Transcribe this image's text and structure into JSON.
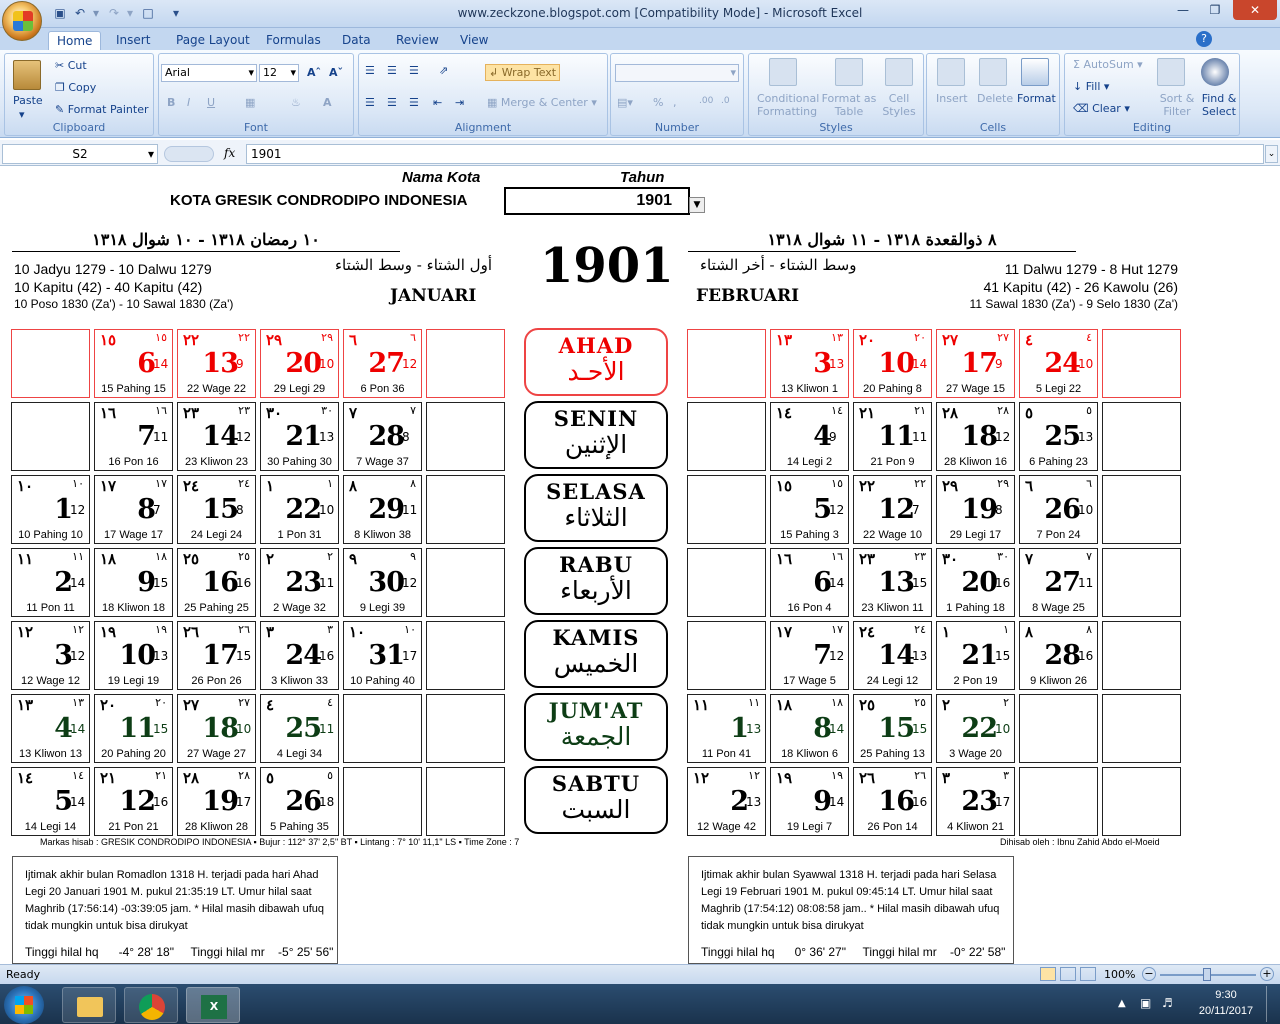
{
  "window": {
    "title": "www.zeckzone.blogspot.com  [Compatibility Mode] - Microsoft Excel"
  },
  "tabs": [
    "Home",
    "Insert",
    "Page Layout",
    "Formulas",
    "Data",
    "Review",
    "View"
  ],
  "ribbon": {
    "clipboard": {
      "paste": "Paste",
      "cut": "Cut",
      "copy": "Copy",
      "format_painter": "Format Painter",
      "label": "Clipboard"
    },
    "font": {
      "name": "Arial",
      "size": "12",
      "label": "Font"
    },
    "alignment": {
      "wrap": "Wrap Text",
      "merge": "Merge & Center",
      "label": "Alignment"
    },
    "number": {
      "label": "Number"
    },
    "styles": {
      "cond": "Conditional Formatting",
      "table": "Format as Table",
      "cell": "Cell Styles",
      "label": "Styles"
    },
    "cells": {
      "insert": "Insert",
      "delete": "Delete",
      "format": "Format",
      "label": "Cells"
    },
    "editing": {
      "autosum": "AutoSum",
      "fill": "Fill",
      "clear": "Clear",
      "sort": "Sort & Filter",
      "find": "Find & Select",
      "label": "Editing"
    }
  },
  "formula_bar": {
    "name_box": "S2",
    "fx": "fx",
    "value": "1901"
  },
  "header": {
    "nama_kota_label": "Nama Kota",
    "tahun_label": "Tahun",
    "kota": "KOTA GRESIK CONDRODIPO INDONESIA",
    "tahun": "1901",
    "big_year": "1901",
    "left_hijri": "١٠ رمضان ١٣١٨  -  ١٠ شوال ١٣١٨",
    "right_hijri": "٨ ذوالقعدة ١٣١٨  -  ١١ شوال ١٣١٨",
    "left_season": "أول الشتاء - وسط الشتاء",
    "right_season": "وسط الشتاء - أخر الشتاء",
    "left_lines": [
      "10 Jadyu 1279 - 10 Dalwu 1279",
      "10 Kapitu (42) - 40 Kapitu (42)",
      "10 Poso 1830 (Za') - 10 Sawal 1830 (Za')"
    ],
    "right_lines": [
      "11 Dalwu 1279 - 8 Hut 1279",
      "41 Kapitu (42) - 26 Kawolu (26)",
      "11 Sawal 1830 (Za') - 9 Selo 1830 (Za')"
    ],
    "month_left": "JANUARI",
    "month_right": "FEBRUARI"
  },
  "days": [
    {
      "en": "AHAD",
      "ar": "الأحـد"
    },
    {
      "en": "SENIN",
      "ar": "الإثنين"
    },
    {
      "en": "SELASA",
      "ar": "الثلاثاء"
    },
    {
      "en": "RABU",
      "ar": "الأربعاء"
    },
    {
      "en": "KAMIS",
      "ar": "الخميس"
    },
    {
      "en": "JUM'AT",
      "ar": "الجمعة"
    },
    {
      "en": "SABTU",
      "ar": "السبت"
    }
  ],
  "january": [
    [
      null,
      {
        "ar": "١٥",
        "ars": "١٥",
        "d": "6",
        "s": "14",
        "jv": "15 Pahing 15"
      },
      {
        "ar": "٢٢",
        "ars": "٢٢",
        "d": "13",
        "s": "9",
        "jv": "22 Wage 22"
      },
      {
        "ar": "٢٩",
        "ars": "٢٩",
        "d": "20",
        "s": "10",
        "jv": "29 Legi 29"
      },
      {
        "ar": "٦",
        "ars": "٦",
        "d": "27",
        "s": "12",
        "jv": "6 Pon 36"
      },
      null
    ],
    [
      null,
      {
        "ar": "١٦",
        "ars": "١٦",
        "d": "7",
        "s": "11",
        "jv": "16 Pon 16"
      },
      {
        "ar": "٢٣",
        "ars": "٢٣",
        "d": "14",
        "s": "12",
        "jv": "23 Kliwon 23"
      },
      {
        "ar": "٣٠",
        "ars": "٣٠",
        "d": "21",
        "s": "13",
        "jv": "30 Pahing 30"
      },
      {
        "ar": "٧",
        "ars": "٧",
        "d": "28",
        "s": "8",
        "jv": "7 Wage 37"
      },
      null
    ],
    [
      {
        "ar": "١٠",
        "ars": "١٠",
        "d": "1",
        "s": "12",
        "jv": "10 Pahing 10"
      },
      {
        "ar": "١٧",
        "ars": "١٧",
        "d": "8",
        "s": "7",
        "jv": "17 Wage 17"
      },
      {
        "ar": "٢٤",
        "ars": "٢٤",
        "d": "15",
        "s": "8",
        "jv": "24 Legi 24"
      },
      {
        "ar": "١",
        "ars": "١",
        "d": "22",
        "s": "10",
        "jv": "1 Pon 31"
      },
      {
        "ar": "٨",
        "ars": "٨",
        "d": "29",
        "s": "11",
        "jv": "8 Kliwon 38"
      },
      null
    ],
    [
      {
        "ar": "١١",
        "ars": "١١",
        "d": "2",
        "s": "14",
        "jv": "11 Pon 11"
      },
      {
        "ar": "١٨",
        "ars": "١٨",
        "d": "9",
        "s": "15",
        "jv": "18 Kliwon 18"
      },
      {
        "ar": "٢٥",
        "ars": "٢٥",
        "d": "16",
        "s": "16",
        "jv": "25 Pahing 25"
      },
      {
        "ar": "٢",
        "ars": "٢",
        "d": "23",
        "s": "11",
        "jv": "2 Wage 32"
      },
      {
        "ar": "٩",
        "ars": "٩",
        "d": "30",
        "s": "12",
        "jv": "9 Legi 39"
      },
      null
    ],
    [
      {
        "ar": "١٢",
        "ars": "١٢",
        "d": "3",
        "s": "12",
        "jv": "12 Wage 12"
      },
      {
        "ar": "١٩",
        "ars": "١٩",
        "d": "10",
        "s": "13",
        "jv": "19 Legi 19"
      },
      {
        "ar": "٢٦",
        "ars": "٢٦",
        "d": "17",
        "s": "15",
        "jv": "26 Pon 26"
      },
      {
        "ar": "٣",
        "ars": "٣",
        "d": "24",
        "s": "16",
        "jv": "3 Kliwon 33"
      },
      {
        "ar": "١٠",
        "ars": "١٠",
        "d": "31",
        "s": "17",
        "jv": "10 Pahing 40"
      },
      null
    ],
    [
      {
        "ar": "١٣",
        "ars": "١٣",
        "d": "4",
        "s": "14",
        "jv": "13 Kliwon 13"
      },
      {
        "ar": "٢٠",
        "ars": "٢٠",
        "d": "11",
        "s": "15",
        "jv": "20 Pahing 20"
      },
      {
        "ar": "٢٧",
        "ars": "٢٧",
        "d": "18",
        "s": "10",
        "jv": "27 Wage 27"
      },
      {
        "ar": "٤",
        "ars": "٤",
        "d": "25",
        "s": "11",
        "jv": "4 Legi 34"
      },
      null,
      null
    ],
    [
      {
        "ar": "١٤",
        "ars": "١٤",
        "d": "5",
        "s": "14",
        "jv": "14 Legi 14"
      },
      {
        "ar": "٢١",
        "ars": "٢١",
        "d": "12",
        "s": "16",
        "jv": "21 Pon 21"
      },
      {
        "ar": "٢٨",
        "ars": "٢٨",
        "d": "19",
        "s": "17",
        "jv": "28 Kliwon 28"
      },
      {
        "ar": "٥",
        "ars": "٥",
        "d": "26",
        "s": "18",
        "jv": "5 Pahing 35"
      },
      null,
      null
    ]
  ],
  "february": [
    [
      null,
      {
        "ar": "١٣",
        "ars": "١٣",
        "d": "3",
        "s": "13",
        "jv": "13 Kliwon 1"
      },
      {
        "ar": "٢٠",
        "ars": "٢٠",
        "d": "10",
        "s": "14",
        "jv": "20 Pahing 8"
      },
      {
        "ar": "٢٧",
        "ars": "٢٧",
        "d": "17",
        "s": "9",
        "jv": "27 Wage 15"
      },
      {
        "ar": "٤",
        "ars": "٤",
        "d": "24",
        "s": "10",
        "jv": "5 Legi 22"
      },
      null
    ],
    [
      null,
      {
        "ar": "١٤",
        "ars": "١٤",
        "d": "4",
        "s": "9",
        "jv": "14 Legi 2"
      },
      {
        "ar": "٢١",
        "ars": "٢١",
        "d": "11",
        "s": "11",
        "jv": "21 Pon 9"
      },
      {
        "ar": "٢٨",
        "ars": "٢٨",
        "d": "18",
        "s": "12",
        "jv": "28 Kliwon 16"
      },
      {
        "ar": "٥",
        "ars": "٥",
        "d": "25",
        "s": "13",
        "jv": "6 Pahing 23"
      },
      null
    ],
    [
      null,
      {
        "ar": "١٥",
        "ars": "١٥",
        "d": "5",
        "s": "12",
        "jv": "15 Pahing 3"
      },
      {
        "ar": "٢٢",
        "ars": "٢٢",
        "d": "12",
        "s": "7",
        "jv": "22 Wage 10"
      },
      {
        "ar": "٢٩",
        "ars": "٢٩",
        "d": "19",
        "s": "8",
        "jv": "29 Legi 17"
      },
      {
        "ar": "٦",
        "ars": "٦",
        "d": "26",
        "s": "10",
        "jv": "7 Pon 24"
      },
      null
    ],
    [
      null,
      {
        "ar": "١٦",
        "ars": "١٦",
        "d": "6",
        "s": "14",
        "jv": "16 Pon 4"
      },
      {
        "ar": "٢٣",
        "ars": "٢٣",
        "d": "13",
        "s": "15",
        "jv": "23 Kliwon 11"
      },
      {
        "ar": "٣٠",
        "ars": "٣٠",
        "d": "20",
        "s": "16",
        "jv": "1 Pahing 18"
      },
      {
        "ar": "٧",
        "ars": "٧",
        "d": "27",
        "s": "11",
        "jv": "8 Wage 25"
      },
      null
    ],
    [
      null,
      {
        "ar": "١٧",
        "ars": "١٧",
        "d": "7",
        "s": "12",
        "jv": "17 Wage 5"
      },
      {
        "ar": "٢٤",
        "ars": "٢٤",
        "d": "14",
        "s": "13",
        "jv": "24 Legi 12"
      },
      {
        "ar": "١",
        "ars": "١",
        "d": "21",
        "s": "15",
        "jv": "2 Pon 19"
      },
      {
        "ar": "٨",
        "ars": "٨",
        "d": "28",
        "s": "16",
        "jv": "9 Kliwon 26"
      },
      null
    ],
    [
      {
        "ar": "١١",
        "ars": "١١",
        "d": "1",
        "s": "13",
        "jv": "11 Pon 41"
      },
      {
        "ar": "١٨",
        "ars": "١٨",
        "d": "8",
        "s": "14",
        "jv": "18 Kliwon 6"
      },
      {
        "ar": "٢٥",
        "ars": "٢٥",
        "d": "15",
        "s": "15",
        "jv": "25 Pahing 13"
      },
      {
        "ar": "٢",
        "ars": "٢",
        "d": "22",
        "s": "10",
        "jv": "3 Wage 20"
      },
      null,
      null
    ],
    [
      {
        "ar": "١٢",
        "ars": "١٢",
        "d": "2",
        "s": "13",
        "jv": "12 Wage 42"
      },
      {
        "ar": "١٩",
        "ars": "١٩",
        "d": "9",
        "s": "14",
        "jv": "19 Legi 7"
      },
      {
        "ar": "٢٦",
        "ars": "٢٦",
        "d": "16",
        "s": "16",
        "jv": "26 Pon 14"
      },
      {
        "ar": "٣",
        "ars": "٣",
        "d": "23",
        "s": "17",
        "jv": "4 Kliwon 21"
      },
      null,
      null
    ]
  ],
  "footer": {
    "markas": "Markas hisab : GRESIK CONDRODIPO INDONESIA  ▪  Bujur : 112° 37' 2,5\" BT  ▪  Lintang : 7° 10' 11,1\" LS  ▪  Time Zone : 7",
    "dihisab": "Dihisab oleh : Ibnu Zahid Abdo el-Moeid",
    "left_note": "Ijtimak akhir bulan Romadlon 1318 H. terjadi pada hari Ahad Legi 20 Januari 1901 M. pukul 21:35:19 LT. Umur hilal saat Maghrib (17:56:14) -03:39:05 jam. * Hilal masih dibawah ufuq tidak mungkin untuk bisa dirukyat",
    "right_note": "Ijtimak akhir bulan Syawwal 1318 H. terjadi pada hari Selasa Legi 19 Februari 1901 M. pukul 09:45:14 LT. Umur hilal saat Maghrib (17:54:12) 08:08:58 jam.. * Hilal masih dibawah ufuq tidak mungkin untuk bisa dirukyat",
    "left_hq": "Tinggi hilal hq      -4° 28' 18\"",
    "left_mr": "Tinggi hilal mr    -5° 25' 56\"",
    "right_hq": "Tinggi hilal hq      0° 36' 27\"",
    "right_mr": "Tinggi hilal mr    -0° 22' 58\""
  },
  "status": {
    "ready": "Ready",
    "zoom": "100%"
  },
  "taskbar": {
    "time": "9:30",
    "date": "20/11/2017"
  },
  "colors": {
    "red": "#e00000",
    "green": "#0d3d15",
    "ribbon": "#dbe7f6"
  }
}
